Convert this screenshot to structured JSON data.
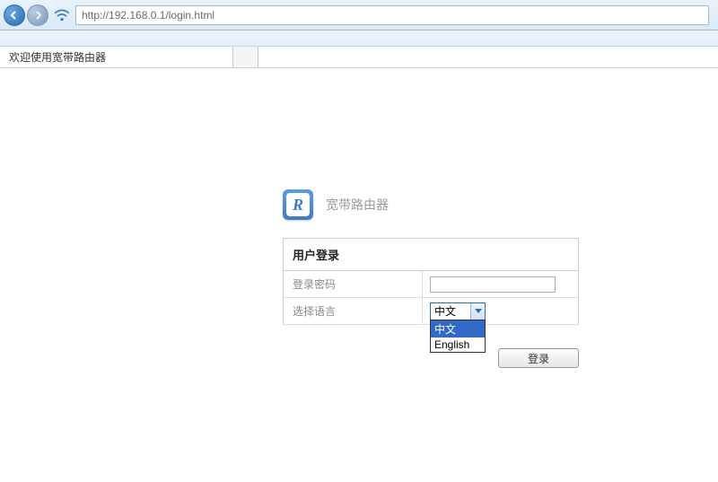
{
  "browser": {
    "url": "http://192.168.0.1/login.html",
    "tab_title": "欢迎使用宽带路由器"
  },
  "brand": {
    "logo_letter": "R",
    "name": "宽带路由器"
  },
  "login": {
    "header": "用户登录",
    "password_label": "登录密码",
    "password_value": "",
    "language_label": "选择语言",
    "language_selected": "中文",
    "language_options": [
      "中文",
      "English"
    ],
    "submit_label": "登录"
  }
}
